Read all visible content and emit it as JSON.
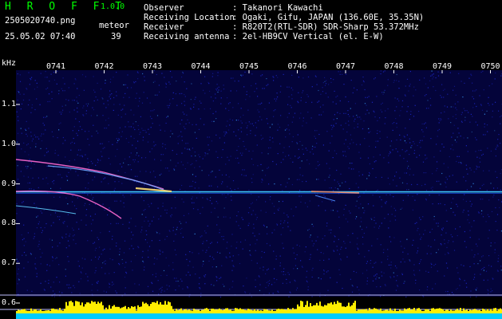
{
  "header": {
    "app_title": "H R O F F T",
    "app_version": "1.0.0",
    "file_name": "2505020740.png",
    "timestamp": "25.05.02 07:40",
    "detection_label": "meteor",
    "detection_count": "39"
  },
  "metadata": {
    "labels": [
      "Observer",
      "Receiving Location",
      "Receiver",
      "Receiving antenna"
    ],
    "values": [
      ": Takanori Kawachi",
      ": Ogaki, Gifu, JAPAN (136.60E, 35.35N)",
      ": R820T2(RTL-SDR) SDR-Sharp 53.372MHz",
      ": 2el-HB9CV Vertical (el. E-W)"
    ]
  },
  "spectrogram": {
    "y_unit": "kHz",
    "y_ticks": [
      "1.1",
      "1.0",
      "0.9",
      "0.8",
      "0.7",
      "0.6"
    ],
    "x_ticks": [
      "0741",
      "0742",
      "0743",
      "0744",
      "0745",
      "0746",
      "0747",
      "0748",
      "0749",
      "0750"
    ],
    "colors": {
      "background": "#04043a",
      "noise": "#1f2bd6",
      "carrier": "#3cc8ff",
      "echo": "#ff6ad0",
      "meter": "#ffee00",
      "meter_base": "#00ccff"
    }
  }
}
